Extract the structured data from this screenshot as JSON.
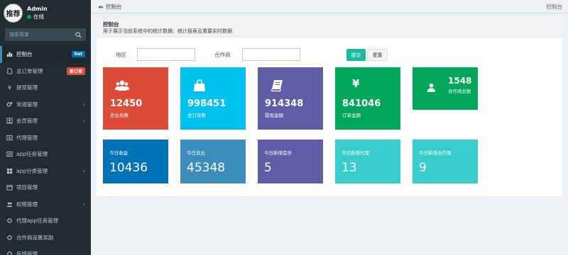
{
  "user": {
    "name": "Admin",
    "status": "在线",
    "avatar_text": "推荐"
  },
  "search": {
    "placeholder": "搜索菜单"
  },
  "menu": [
    {
      "label": "控制台",
      "badge": "hot",
      "badge_color": "#0073b7",
      "active": true,
      "icon": "dashboard-icon"
    },
    {
      "label": "总订单管理",
      "badge": "新订单",
      "badge_color": "#dd4b39",
      "icon": "file-icon"
    },
    {
      "label": "提现管理",
      "icon": "yen-icon"
    },
    {
      "label": "常规管理",
      "chevron": true,
      "icon": "cogs-icon"
    },
    {
      "label": "会员管理",
      "chevron": true,
      "icon": "user-icon"
    },
    {
      "label": "代理管理",
      "icon": "list-icon"
    },
    {
      "label": "app任务管理",
      "icon": "list-icon"
    },
    {
      "label": "app分类管理",
      "chevron": true,
      "icon": "category-icon"
    },
    {
      "label": "项目管理",
      "icon": "calendar-icon"
    },
    {
      "label": "权限管理",
      "chevron": true,
      "icon": "users-icon"
    },
    {
      "label": "代理app任务管理",
      "icon": "circle-icon"
    },
    {
      "label": "合作商设置奖励",
      "icon": "circle-icon"
    },
    {
      "label": "反馈管理",
      "icon": "circle-icon"
    }
  ],
  "topbar": {
    "breadcrumb": "控制台",
    "right_title": "控制台"
  },
  "panel": {
    "title": "控制台",
    "description": "用于展示当前系统中的统计数据、统计报表及重要实时数据"
  },
  "filter": {
    "region_label": "地区",
    "partner_label": "合作商",
    "submit_label": "提交",
    "reset_label": "重置"
  },
  "cards": [
    {
      "value": "12450",
      "label": "总会员数",
      "color": "#dd4b39",
      "icon": "users-icon"
    },
    {
      "value": "998451",
      "label": "总订单数",
      "color": "#00c0ef",
      "icon": "shopping-bag-icon"
    },
    {
      "value": "914348",
      "label": "提现金额",
      "color": "#605ca8",
      "icon": "book-icon"
    },
    {
      "value": "841046",
      "label": "订单金额",
      "color": "#00a65a",
      "icon": "yen-icon",
      "glyph": "¥"
    },
    {
      "value": "1548",
      "label": "合作商总数",
      "color": "#00a65a",
      "icon": "user-icon"
    }
  ],
  "stats": [
    {
      "label": "今日收益",
      "value": "10436",
      "color": "#0073b7"
    },
    {
      "label": "今日支出",
      "value": "45348",
      "color": "#3c8dbc"
    },
    {
      "label": "今日新增会员",
      "value": "5",
      "color": "#605ca8"
    },
    {
      "label": "今日新增代理",
      "value": "13",
      "color": "#39cccc"
    },
    {
      "label": "今日新增合作商",
      "value": "9",
      "color": "#39cccc"
    }
  ]
}
